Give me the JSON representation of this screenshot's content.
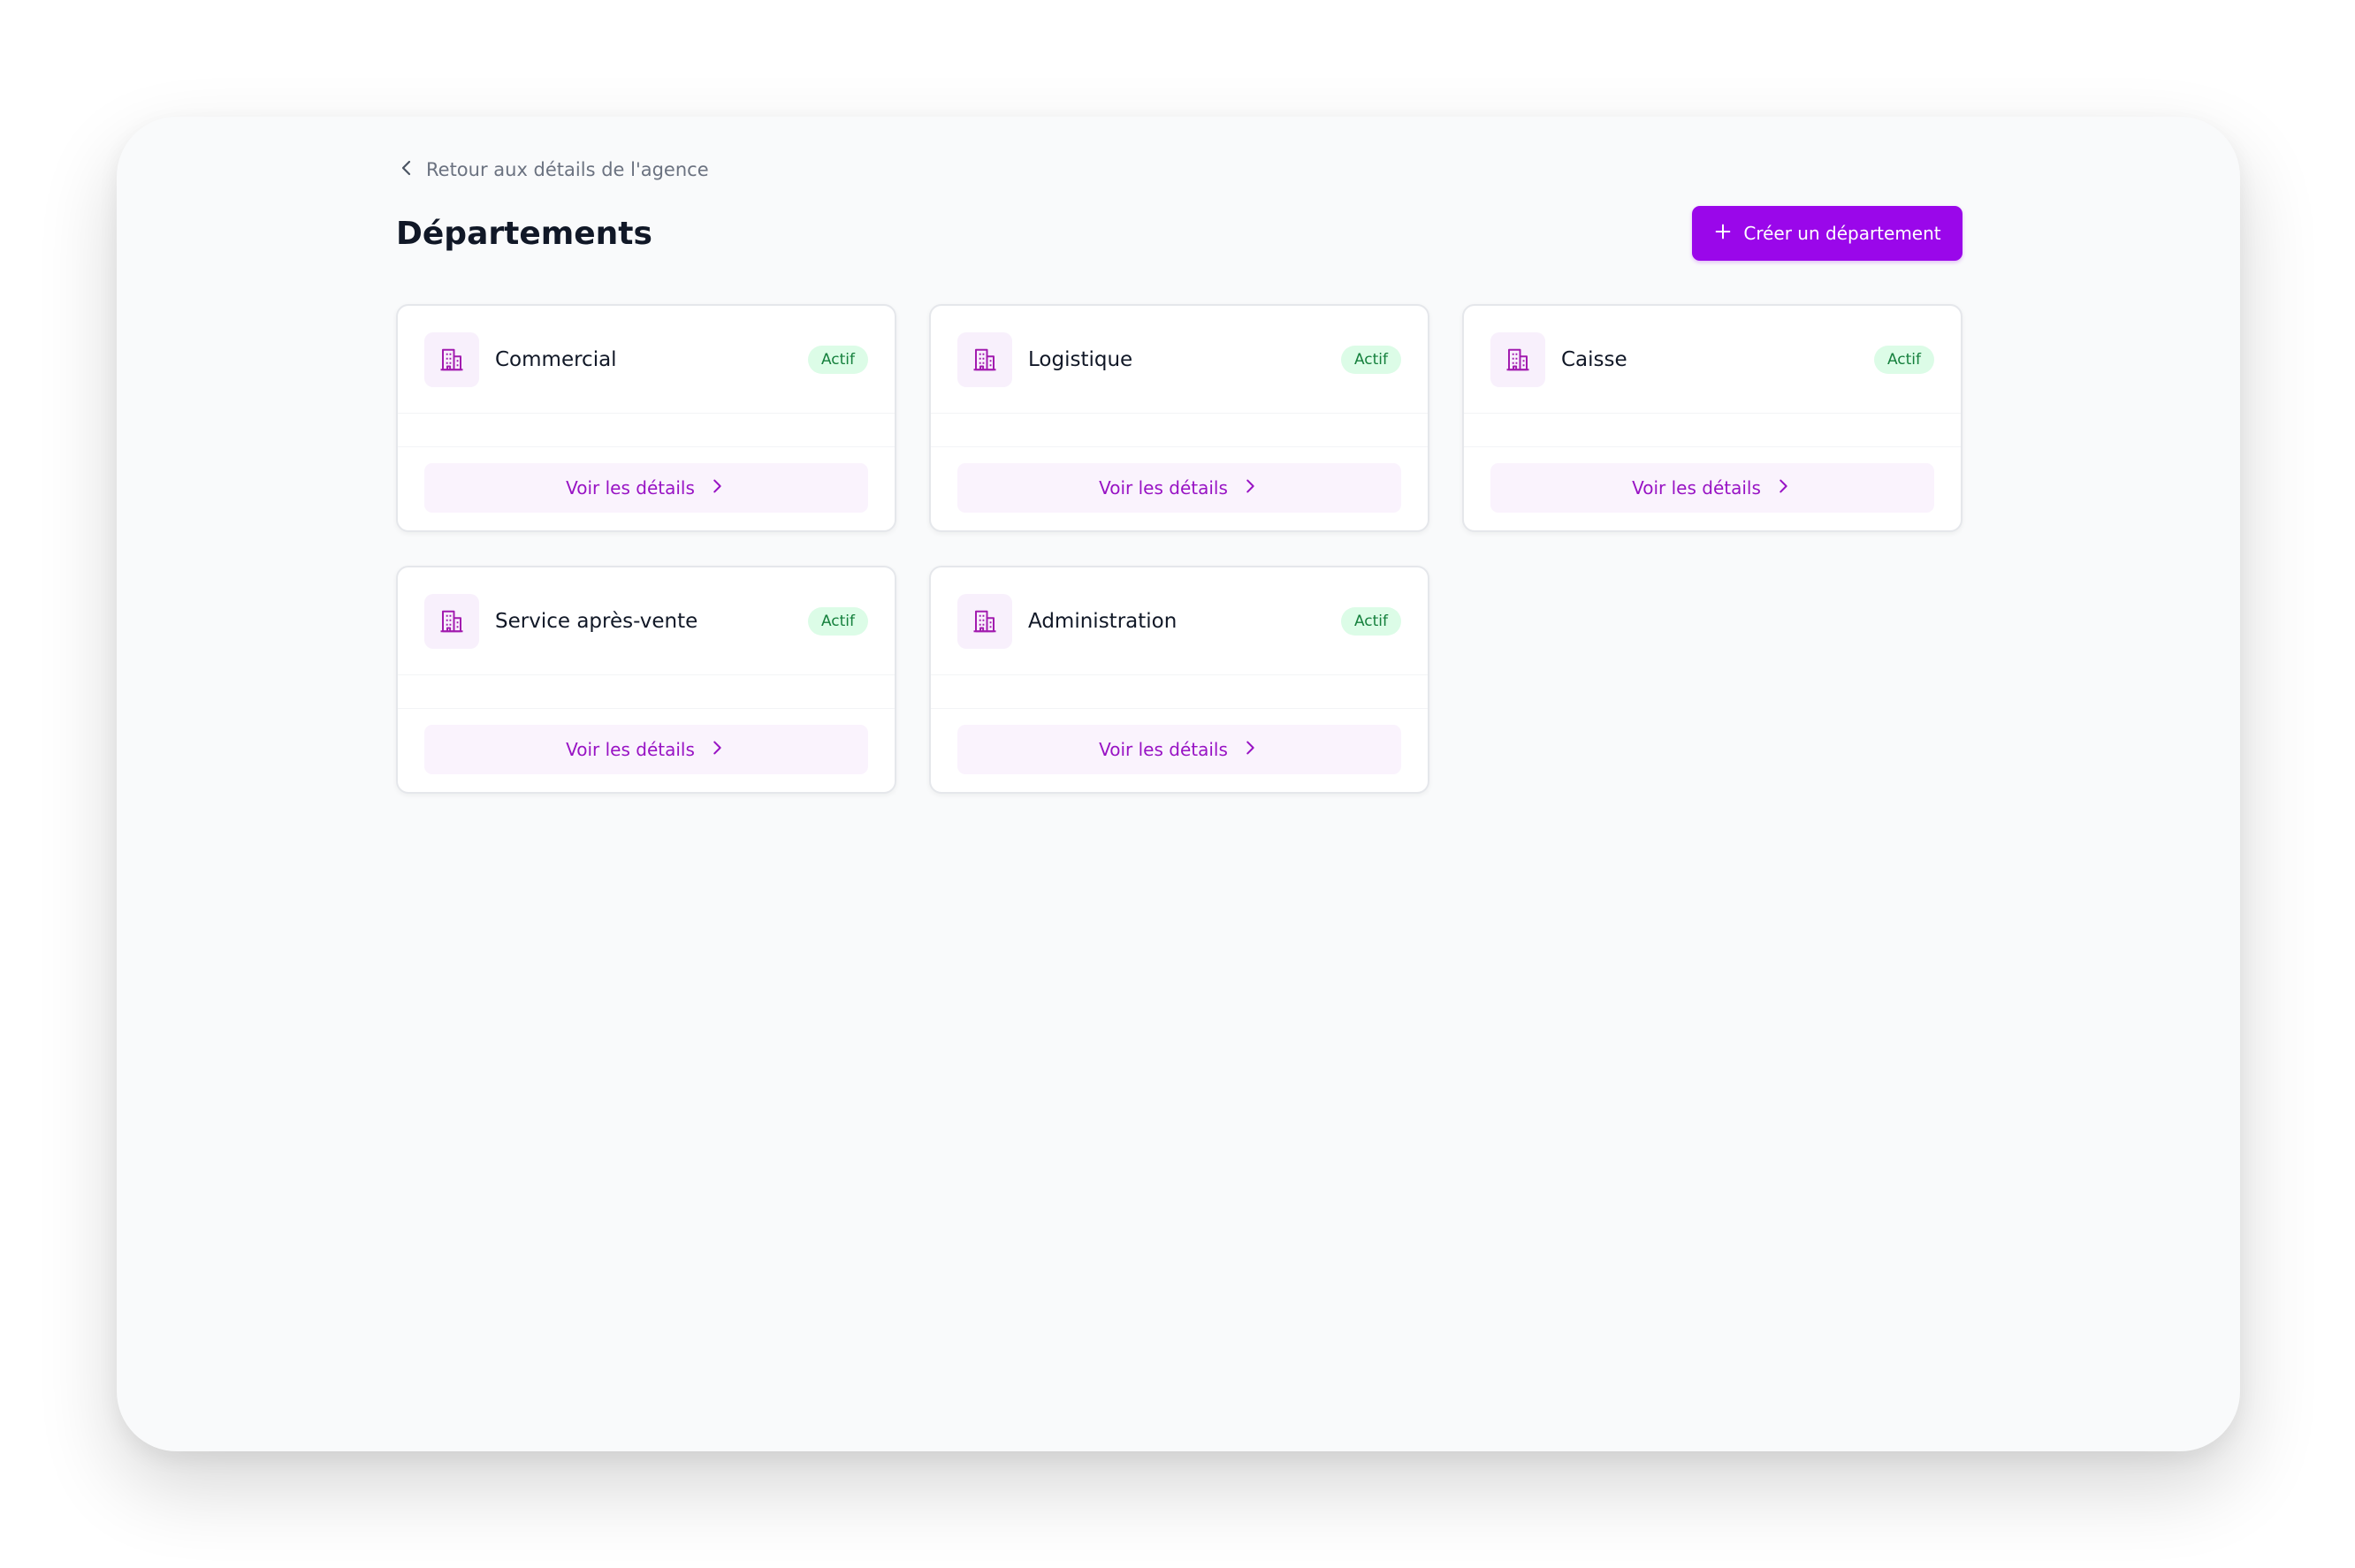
{
  "header": {
    "back_label": "Retour aux détails de l'agence",
    "title": "Départements",
    "create_label": "Créer un département"
  },
  "departments": [
    {
      "name": "Commercial",
      "status": "Actif",
      "details_label": "Voir les détails"
    },
    {
      "name": "Logistique",
      "status": "Actif",
      "details_label": "Voir les détails"
    },
    {
      "name": "Caisse",
      "status": "Actif",
      "details_label": "Voir les détails"
    },
    {
      "name": "Service après-vente",
      "status": "Actif",
      "details_label": "Voir les détails"
    },
    {
      "name": "Administration",
      "status": "Actif",
      "details_label": "Voir les détails"
    }
  ],
  "icons": {
    "back": "chevron-left-icon",
    "create": "plus-icon",
    "department": "building-icon",
    "details": "chevron-right-icon"
  },
  "colors": {
    "accent": "#9a07ea",
    "accent_text": "#9813c4",
    "icon_bg": "#f8f0fc",
    "badge_bg": "#dcfce7",
    "badge_text": "#15803d",
    "page_bg": "#f9fafb"
  }
}
